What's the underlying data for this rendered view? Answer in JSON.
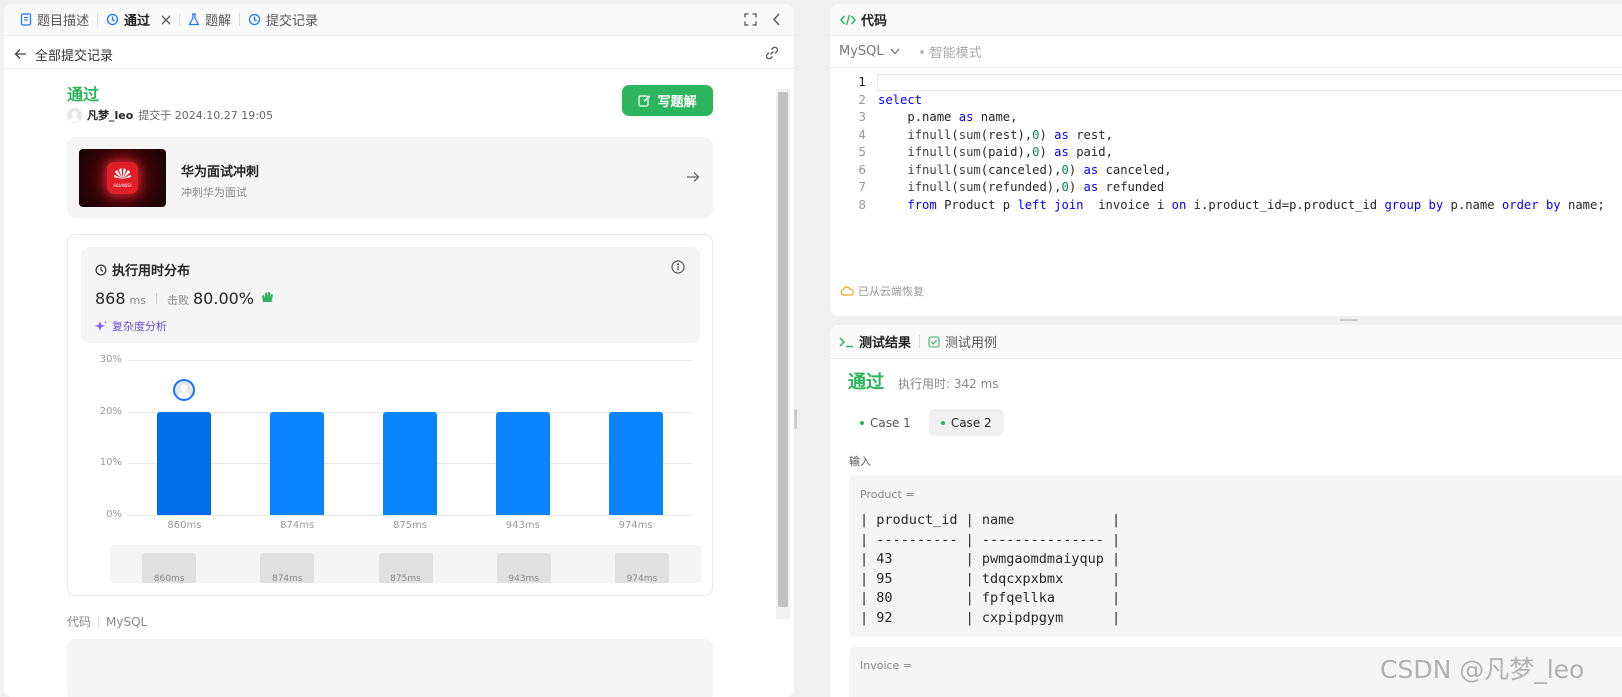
{
  "left_tabs": [
    {
      "label": "题目描述"
    },
    {
      "label": "通过"
    },
    {
      "label": "题解"
    },
    {
      "label": "提交记录"
    }
  ],
  "back": {
    "label": "全部提交记录"
  },
  "submission": {
    "status": "通过",
    "user": "凡梦_leo",
    "submitted_at": "提交于 2024.10.27 19:05",
    "write_solution": "写题解"
  },
  "promo": {
    "title": "华为面试冲刺",
    "subtitle": "冲刺华为面试",
    "logo_text": "HUAWEI"
  },
  "runtime": {
    "title": "执行用时分布",
    "value": "868",
    "unit": "ms",
    "beat_label": "击败",
    "beat_value": "80.00%",
    "complexity_link": "复杂度分析"
  },
  "chart_data": {
    "type": "bar",
    "categories": [
      "860ms",
      "874ms",
      "875ms",
      "943ms",
      "974ms"
    ],
    "values": [
      20,
      20,
      20,
      20,
      20
    ],
    "y_ticks": [
      "30%",
      "20%",
      "10%",
      "0%"
    ],
    "ylim": [
      0,
      30
    ],
    "highlight_index": 0,
    "grid": true
  },
  "minimap": [
    "860ms",
    "874ms",
    "875ms",
    "943ms",
    "974ms"
  ],
  "code_footer": {
    "label": "代码",
    "lang": "MySQL"
  },
  "editor": {
    "title": "代码",
    "lang": "MySQL",
    "mode": "智能模式",
    "restore_notice": "已从云端恢复",
    "line_numbers": [
      "1",
      "2",
      "3",
      "4",
      "5",
      "6",
      "7",
      "8"
    ],
    "lines": [
      "",
      "select",
      "    p.name as name,",
      "    ifnull(sum(rest),0) as rest,",
      "    ifnull(sum(paid),0) as paid,",
      "    ifnull(sum(canceled),0) as canceled,",
      "    ifnull(sum(refunded),0) as refunded",
      "    from Product p left join  invoice i on i.product_id=p.product_id group by p.name order by name;"
    ]
  },
  "result": {
    "tab_result": "测试结果",
    "tab_cases": "测试用例",
    "status": "通过",
    "runtime": "执行用时: 342 ms",
    "cases": [
      "Case 1",
      "Case 2"
    ],
    "input_label": "输入",
    "product_label": "Product =",
    "product_table": [
      "| product_id | name            |",
      "| ---------- | --------------- |",
      "| 43         | pwmgaomdmaiyqup |",
      "| 95         | tdqcxpxbmx      |",
      "| 80         | fpfqellka       |",
      "| 92         | cxpipdpgym      |"
    ],
    "invoice_label": "Invoice ="
  },
  "watermark": "CSDN @凡梦_leo",
  "colors": {
    "accent_green": "#2db55d",
    "bar_blue": "#0a84ff",
    "bar_highlight": "#006ee6",
    "keyword": "#0000ff"
  }
}
